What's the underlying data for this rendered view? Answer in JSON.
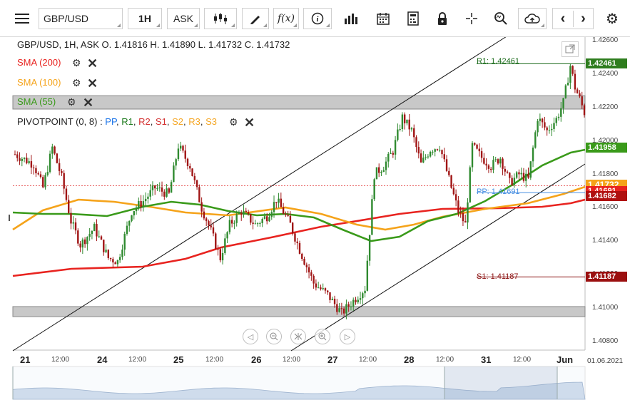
{
  "toolbar": {
    "symbol": "GBP/USD",
    "timeframe": "1H",
    "price_side": "ASK",
    "fx_label": "f(x)",
    "info_label": "i"
  },
  "legend": {
    "header": "GBP/USD, 1H, ASK   O. 1.41816 H. 1.41890 L. 1.41732 C. 1.41732",
    "sma200": "SMA (200)",
    "sma100": "SMA (100)",
    "sma55": "SMA (55)",
    "pivot_name": "PIVOTPOINT (0, 8)",
    "pivot_sep": " : ",
    "pivot_items": [
      {
        "text": "PP",
        "color": "#1a73e8"
      },
      {
        "text": "R1",
        "color": "#1b7a1b"
      },
      {
        "text": "R2",
        "color": "#d32f2f"
      },
      {
        "text": "S1",
        "color": "#d32f2f"
      },
      {
        "text": "S2",
        "color": "#f5a623"
      },
      {
        "text": "R3",
        "color": "#f5a623"
      },
      {
        "text": "S3",
        "color": "#f5a623"
      }
    ],
    "x_label": "✕"
  },
  "colors": {
    "sma200": "#e8231f",
    "sma100": "#f5a31a",
    "sma55": "#3a9a1a",
    "bull": "#2f8a2f",
    "bear": "#a01515",
    "channel": "#111111",
    "zone": "#c8c8c8",
    "r1": "#1b6b1b",
    "s1": "#8b1010",
    "pp": "#4a90e2",
    "current": "#e03030"
  },
  "levels": {
    "r1_label": "R1: 1.42461",
    "pp_label": "PP: 1.41691",
    "s1_label": "S1: 1.41187"
  },
  "price_labels": [
    {
      "text": "1.42461",
      "value": 1.42461,
      "color": "#2e7d1e"
    },
    {
      "text": "1.41958",
      "value": 1.41958,
      "color": "#3a9a1a"
    },
    {
      "text": "1.41732",
      "value": 1.41732,
      "color": "#f5a31a"
    },
    {
      "text": "1.41691",
      "value": 1.41691,
      "color": "#e8231f"
    },
    {
      "text": "1.41682",
      "value": 1.41682,
      "color": "#b01010"
    },
    {
      "text": "1.41187",
      "value": 1.41187,
      "color": "#9b1010"
    }
  ],
  "yaxis": [
    "1.42600",
    "1.42400",
    "1.42200",
    "1.42000",
    "1.41800",
    "1.41600",
    "1.41400",
    "1.41200",
    "1.41000",
    "1.40800"
  ],
  "xaxis": [
    {
      "label": "21",
      "bold": true
    },
    {
      "label": "12:00",
      "bold": false
    },
    {
      "label": "24",
      "bold": true
    },
    {
      "label": "12:00",
      "bold": false
    },
    {
      "label": "25",
      "bold": true
    },
    {
      "label": "12:00",
      "bold": false
    },
    {
      "label": "26",
      "bold": true
    },
    {
      "label": "12:00",
      "bold": false
    },
    {
      "label": "27",
      "bold": true
    },
    {
      "label": "12:00",
      "bold": false
    },
    {
      "label": "28",
      "bold": true
    },
    {
      "label": "12:00",
      "bold": false
    },
    {
      "label": "31",
      "bold": true
    },
    {
      "label": "12:00",
      "bold": false
    },
    {
      "label": "Jun",
      "bold": true
    }
  ],
  "date_label": "01.06.2021",
  "chart_data": {
    "type": "candlestick",
    "ylim": [
      1.4075,
      1.4265
    ],
    "zones": [
      {
        "from": 1.4219,
        "to": 1.4227
      },
      {
        "from": 1.4095,
        "to": 1.4101
      }
    ],
    "levels": {
      "R1": 1.42461,
      "PP": 1.41691,
      "S1": 1.41187
    },
    "current": 1.41732
  }
}
